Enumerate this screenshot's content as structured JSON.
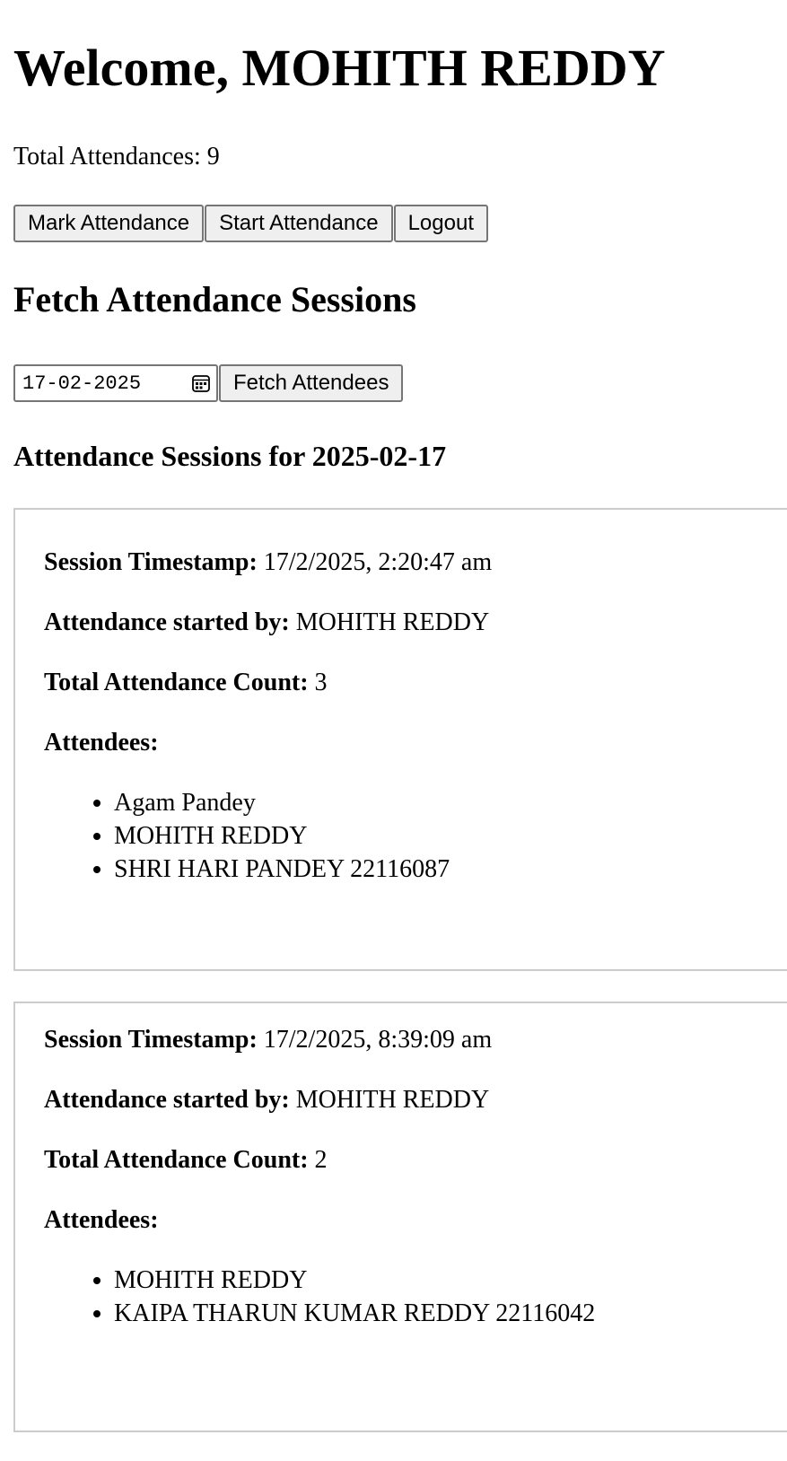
{
  "header": {
    "welcome": "Welcome, MOHITH REDDY",
    "total_attendances": "Total Attendances: 9"
  },
  "actions": {
    "mark_label": "Mark Attendance",
    "start_label": "Start Attendance",
    "logout_label": "Logout"
  },
  "fetch": {
    "title": "Fetch Attendance Sessions",
    "date_value": "17-02-2025",
    "button_label": "Fetch Attendees",
    "calendar_icon": "calendar-icon"
  },
  "sessions_heading": "Attendance Sessions for 2025-02-17",
  "labels": {
    "timestamp": "Session Timestamp:",
    "started_by": "Attendance started by:",
    "count": "Total Attendance Count:",
    "attendees": "Attendees:"
  },
  "sessions": [
    {
      "timestamp": "17/2/2025, 2:20:47 am",
      "started_by": "MOHITH REDDY",
      "count": "3",
      "attendees": [
        "Agam Pandey",
        "MOHITH REDDY",
        "SHRI HARI PANDEY 22116087"
      ]
    },
    {
      "timestamp": "17/2/2025, 8:39:09 am",
      "started_by": "MOHITH REDDY",
      "count": "2",
      "attendees": [
        "MOHITH REDDY",
        "KAIPA THARUN KUMAR REDDY 22116042"
      ]
    }
  ]
}
